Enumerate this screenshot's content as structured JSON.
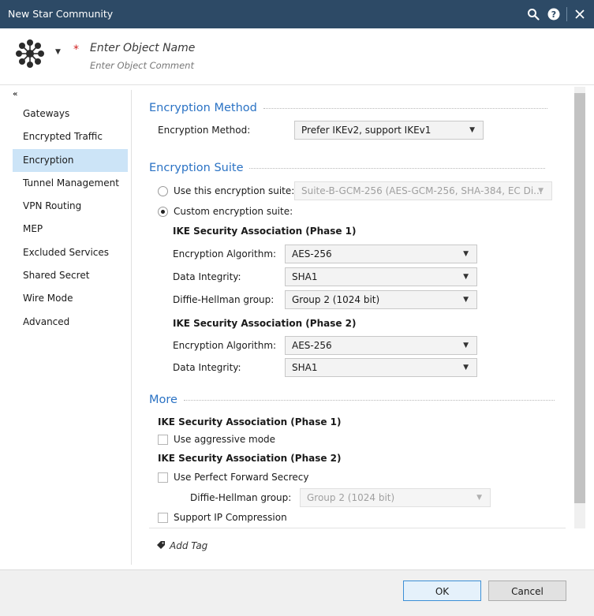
{
  "window": {
    "title": "New Star Community"
  },
  "header": {
    "object_name_placeholder": "Enter Object Name",
    "object_comment_placeholder": "Enter Object Comment",
    "required_marker": "*"
  },
  "nav": {
    "collapse_glyph": "«",
    "items": [
      {
        "label": "Gateways",
        "active": false
      },
      {
        "label": "Encrypted Traffic",
        "active": false
      },
      {
        "label": "Encryption",
        "active": true
      },
      {
        "label": "Tunnel Management",
        "active": false
      },
      {
        "label": "VPN Routing",
        "active": false
      },
      {
        "label": "MEP",
        "active": false
      },
      {
        "label": "Excluded Services",
        "active": false
      },
      {
        "label": "Shared Secret",
        "active": false
      },
      {
        "label": "Wire Mode",
        "active": false
      },
      {
        "label": "Advanced",
        "active": false
      }
    ]
  },
  "encryption_method": {
    "section_title": "Encryption Method",
    "label": "Encryption Method:",
    "value": "Prefer IKEv2, support IKEv1"
  },
  "encryption_suite": {
    "section_title": "Encryption Suite",
    "use_suite_label": "Use this encryption suite:",
    "use_suite_value": "Suite-B-GCM-256 (AES-GCM-256, SHA-384, EC Di...",
    "custom_suite_label": "Custom encryption suite:",
    "selected": "custom",
    "phase1": {
      "title": "IKE Security Association (Phase 1)",
      "enc_alg_label": "Encryption Algorithm:",
      "enc_alg_value": "AES-256",
      "integrity_label": "Data Integrity:",
      "integrity_value": "SHA1",
      "dh_label": "Diffie-Hellman group:",
      "dh_value": "Group 2 (1024 bit)"
    },
    "phase2": {
      "title": "IKE Security Association (Phase 2)",
      "enc_alg_label": "Encryption Algorithm:",
      "enc_alg_value": "AES-256",
      "integrity_label": "Data Integrity:",
      "integrity_value": "SHA1"
    }
  },
  "more": {
    "section_title": "More",
    "phase1_title": "IKE Security Association (Phase 1)",
    "aggressive_label": "Use aggressive mode",
    "aggressive_checked": false,
    "phase2_title": "IKE Security Association (Phase 2)",
    "pfs_label": "Use Perfect Forward Secrecy",
    "pfs_checked": false,
    "pfs_dh_label": "Diffie-Hellman group:",
    "pfs_dh_value": "Group 2 (1024 bit)",
    "compression_label": "Support IP Compression",
    "compression_checked": false
  },
  "tags": {
    "add_tag_label": "Add Tag"
  },
  "footer": {
    "ok_label": "OK",
    "cancel_label": "Cancel"
  },
  "colors": {
    "titlebar": "#2d4a66",
    "section_title": "#2a72c4",
    "active_nav": "#cce4f7",
    "required": "#d02020"
  }
}
